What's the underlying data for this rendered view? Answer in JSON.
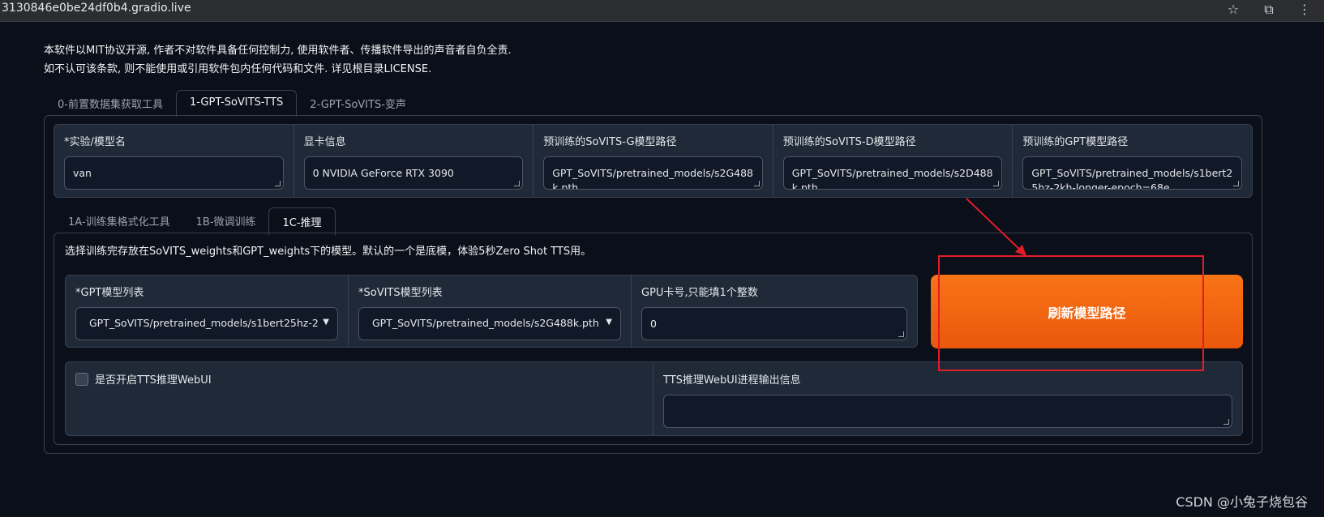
{
  "browser": {
    "url": "3130846e0be24df0b4.gradio.live"
  },
  "notice": {
    "line1": "本软件以MIT协议开源, 作者不对软件具备任何控制力, 使用软件者、传播软件导出的声音者自负全责.",
    "line2": "如不认可该条款, 则不能使用或引用软件包内任何代码和文件. 详见根目录LICENSE."
  },
  "top_tabs": [
    "0-前置数据集获取工具",
    "1-GPT-SoVITS-TTS",
    "2-GPT-SoVITS-变声"
  ],
  "fields": {
    "exp_name": {
      "label": "*实验/模型名",
      "value": "van"
    },
    "gpu_info": {
      "label": "显卡信息",
      "value": "0 NVIDIA GeForce RTX 3090"
    },
    "sovits_g": {
      "label": "预训练的SoVITS-G模型路径",
      "value": "GPT_SoVITS/pretrained_models/s2G488k.pth"
    },
    "sovits_d": {
      "label": "预训练的SoVITS-D模型路径",
      "value": "GPT_SoVITS/pretrained_models/s2D488k.pth"
    },
    "gpt": {
      "label": "预训练的GPT模型路径",
      "value": "GPT_SoVITS/pretrained_models/s1bert25hz-2kh-longer-epoch=68e"
    }
  },
  "sub_tabs": [
    "1A-训练集格式化工具",
    "1B-微调训练",
    "1C-推理"
  ],
  "inference": {
    "description": "选择训练完存放在SoVITS_weights和GPT_weights下的模型。默认的一个是底模，体验5秒Zero Shot TTS用。",
    "gpt_list": {
      "label": "*GPT模型列表",
      "value": "GPT_SoVITS/pretrained_models/s1bert25hz-2"
    },
    "sovits_list": {
      "label": "*SoVITS模型列表",
      "value": "GPT_SoVITS/pretrained_models/s2G488k.pth"
    },
    "gpu_index": {
      "label": "GPU卡号,只能填1个整数",
      "value": "0"
    },
    "refresh_button": "刷新模型路径",
    "tts_webui_checkbox": "是否开启TTS推理WebUI",
    "tts_output": {
      "label": "TTS推理WebUI进程输出信息",
      "value": ""
    }
  },
  "watermark": "CSDN @小兔子烧包谷",
  "colors": {
    "accent": "#f97316",
    "annotation": "#e11d2a",
    "background": "#0b0f19"
  }
}
